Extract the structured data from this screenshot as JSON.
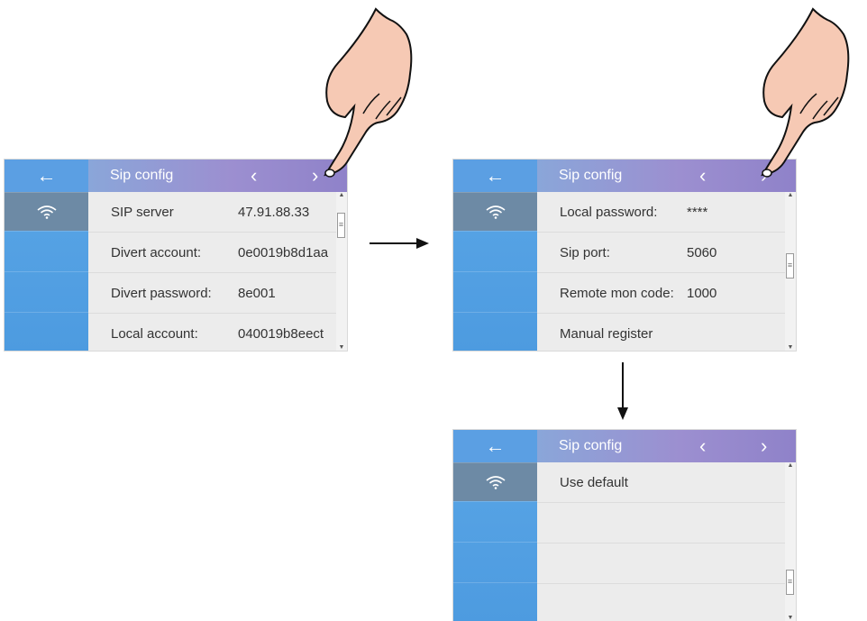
{
  "screens": [
    {
      "title": "Sip config",
      "back_icon": "arrow-left-icon",
      "rows": [
        {
          "label": "SIP server",
          "value": "47.91.88.33"
        },
        {
          "label": "Divert account:",
          "value": "0e0019b8d1aa"
        },
        {
          "label": "Divert password:",
          "value": "8e001"
        },
        {
          "label": "Local account:",
          "value": "040019b8eect"
        }
      ],
      "scroll_position": 0.1
    },
    {
      "title": "Sip config",
      "back_icon": "arrow-left-icon",
      "rows": [
        {
          "label": "Local password:",
          "value": "****"
        },
        {
          "label": "Sip port:",
          "value": "5060"
        },
        {
          "label": "Remote mon code:",
          "value": "1000"
        },
        {
          "label": "Manual register",
          "value": ""
        }
      ],
      "scroll_position": 0.45
    },
    {
      "title": "Sip config",
      "back_icon": "arrow-left-icon",
      "rows": [
        {
          "label": "Use default",
          "value": ""
        },
        {
          "label": "",
          "value": ""
        },
        {
          "label": "",
          "value": ""
        },
        {
          "label": "",
          "value": ""
        }
      ],
      "scroll_position": 0.85
    }
  ],
  "glyphs": {
    "back": "←",
    "prev": "‹",
    "next": "›",
    "scroll_up": "▲",
    "scroll_down": "▼"
  },
  "colors": {
    "sidebar": "#4d9be0",
    "header_start": "#8aa6d9",
    "header_end": "#8f82c9",
    "active_item": "#6d8aa5"
  }
}
